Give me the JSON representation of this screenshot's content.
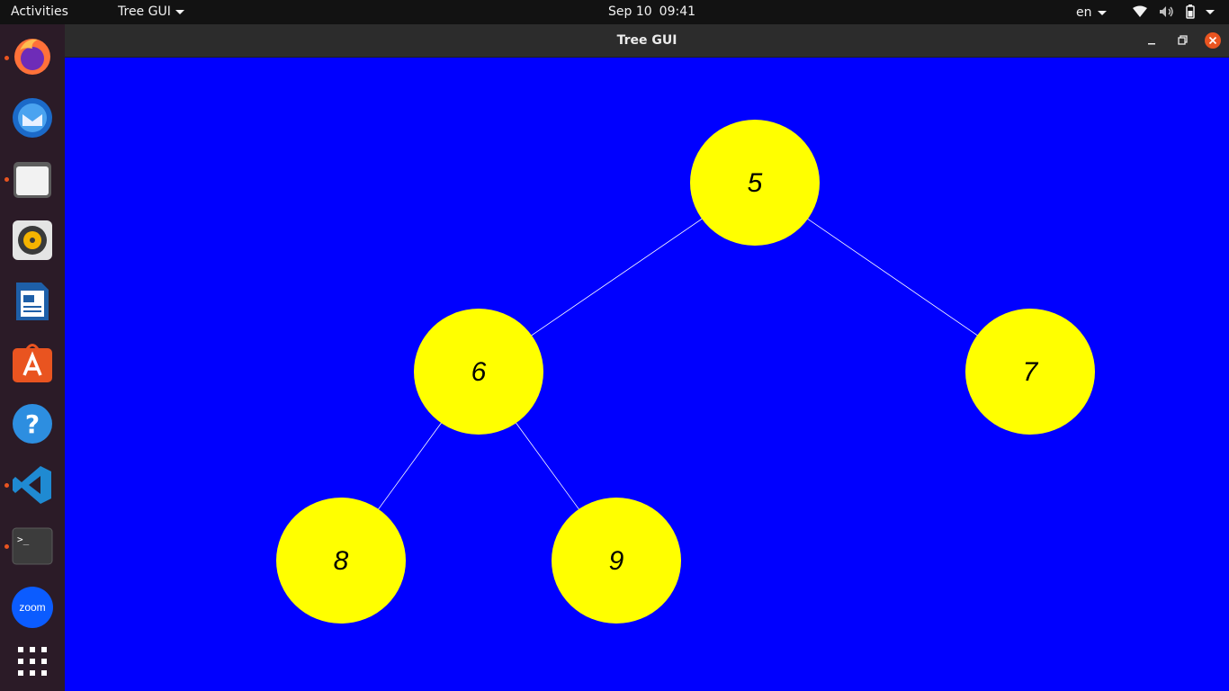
{
  "topbar": {
    "activities": "Activities",
    "app_menu": "Tree GUI",
    "date": "Sep 10",
    "time": "09:41",
    "language": "en"
  },
  "dock": {
    "items": [
      "firefox-icon",
      "thunderbird-icon",
      "files-icon",
      "rhythmbox-icon",
      "libreoffice-writer-icon",
      "app-center-icon",
      "help-icon",
      "vscode-icon",
      "terminal-icon",
      "zoom-icon",
      "show-apps-icon"
    ],
    "zoom_label": "zoom",
    "terminal_prompt": ">_"
  },
  "window": {
    "title": "Tree GUI"
  },
  "tree": {
    "background": "#0000ff",
    "node_color": "#ffff00",
    "edge_color": "#ffffff",
    "nodes": [
      {
        "id": "n5",
        "label": "5"
      },
      {
        "id": "n6",
        "label": "6"
      },
      {
        "id": "n7",
        "label": "7"
      },
      {
        "id": "n8",
        "label": "8"
      },
      {
        "id": "n9",
        "label": "9"
      }
    ],
    "edges": [
      [
        "n5",
        "n6"
      ],
      [
        "n5",
        "n7"
      ],
      [
        "n6",
        "n8"
      ],
      [
        "n6",
        "n9"
      ]
    ]
  }
}
